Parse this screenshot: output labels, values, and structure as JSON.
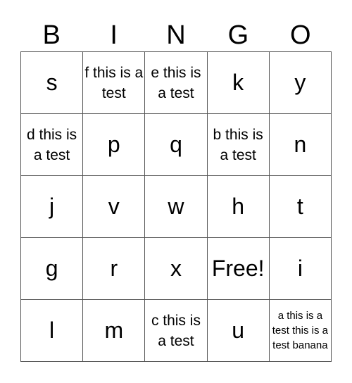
{
  "header": [
    "B",
    "I",
    "N",
    "G",
    "O"
  ],
  "grid": [
    [
      "s",
      "f this is a test",
      "e this is a test",
      "k",
      "y"
    ],
    [
      "d this is a test",
      "p",
      "q",
      "b this is a test",
      "n"
    ],
    [
      "j",
      "v",
      "w",
      "h",
      "t"
    ],
    [
      "g",
      "r",
      "x",
      "Free!",
      "i"
    ],
    [
      "l",
      "m",
      "c this is a test",
      "u",
      "a this is a test this is a test banana"
    ]
  ]
}
